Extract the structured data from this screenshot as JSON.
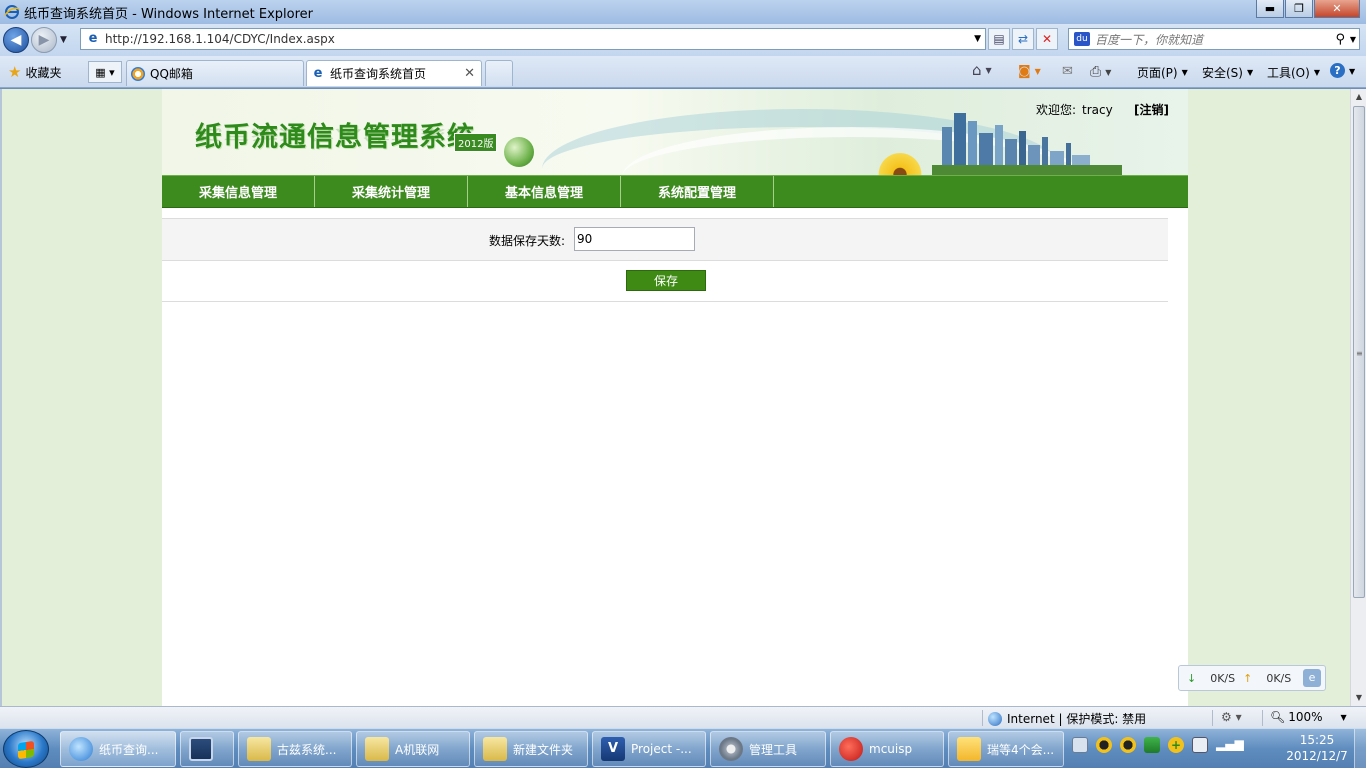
{
  "window": {
    "title": "纸币查询系统首页 - Windows Internet Explorer",
    "controls": {
      "minimize": "▬",
      "maximize": "❐",
      "close": "✕"
    }
  },
  "address_bar": {
    "url": "http://192.168.1.104/CDYC/Index.aspx",
    "search_placeholder": "百度一下，你就知道",
    "search_engine_icon": "baidu-paw-icon"
  },
  "command_bar": {
    "favorites_label": "收藏夹",
    "tabs": [
      {
        "label": "QQ邮箱",
        "active": false
      },
      {
        "label": "纸币查询系统首页",
        "active": true
      }
    ],
    "page_menu": "页面(P)",
    "safety_menu": "安全(S)",
    "tools_menu": "工具(O)",
    "help_glyph": "?"
  },
  "site": {
    "title": "纸币流通信息管理系统",
    "version_badge": "2012版",
    "welcome_label": "欢迎您:",
    "username": "tracy",
    "logout_label": "[注销]",
    "nav": [
      "采集信息管理",
      "采集统计管理",
      "基本信息管理",
      "系统配置管理"
    ],
    "form": {
      "days_label": "数据保存天数:",
      "days_value": "90",
      "save_label": "保存"
    }
  },
  "netspeed": {
    "down": "0K/S",
    "up": "0K/S"
  },
  "status_bar": {
    "zone": "Internet | 保护模式: 禁用",
    "zoom": "100%"
  },
  "taskbar": {
    "tasks": [
      {
        "label": "纸币查询...",
        "icon": "ie-icon",
        "active": true
      },
      {
        "label": "",
        "icon": "film-icon",
        "active": false
      },
      {
        "label": "古兹系统...",
        "icon": "folder-icon",
        "active": false
      },
      {
        "label": "A机联网",
        "icon": "folder-icon",
        "active": false
      },
      {
        "label": "新建文件夹",
        "icon": "folder-icon",
        "active": false
      },
      {
        "label": "Project -...",
        "icon": "visio-icon",
        "active": false
      },
      {
        "label": "管理工具",
        "icon": "gear-icon",
        "active": false
      },
      {
        "label": "mcuisp",
        "icon": "mcuisp-icon",
        "active": false
      },
      {
        "label": "瑞等4个会...",
        "icon": "note-icon",
        "active": false
      }
    ],
    "clock_time": "15:25",
    "clock_date": "2012/12/7"
  },
  "colors": {
    "brand_green": "#3d8a1f",
    "title_green": "#2f8a1c",
    "page_background": "#e3efd8"
  }
}
